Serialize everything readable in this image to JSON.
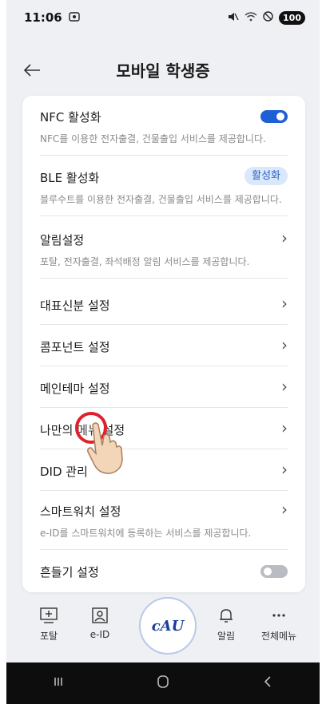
{
  "status_bar": {
    "time": "11:06",
    "battery": "100"
  },
  "header": {
    "title": "모바일 학생증"
  },
  "settings": {
    "nfc": {
      "label": "NFC 활성화",
      "desc": "NFC를 이용한 전자출결, 건물출입 서비스를 제공합니다.",
      "enabled": true
    },
    "ble": {
      "label": "BLE 활성화",
      "desc": "블루수트를 이용한 전자출결, 건물출입 서비스를 제공합니다.",
      "badge": "활성화"
    },
    "alarm": {
      "label": "알림설정",
      "desc": "포탈, 전자출결, 좌석배정 알림 서비스를 제공합니다."
    },
    "identity": {
      "label": "대표신분 설정"
    },
    "component": {
      "label": "콤포넌트 설정"
    },
    "theme": {
      "label": "메인테마 설정"
    },
    "mymenu": {
      "label": "나만의 메뉴 설정"
    },
    "did": {
      "label": "DID 관리"
    },
    "smartwatch": {
      "label": "스마트워치 설정",
      "desc": "e-ID를 스마트워치에 등록하는 서비스를 제공합니다."
    },
    "shake": {
      "label": "흔들기 설정",
      "enabled": false
    }
  },
  "bottom_nav": {
    "portal": "포탈",
    "eid": "e-ID",
    "center_logo": "cAU",
    "alarm": "알림",
    "all_menu": "전체메뉴"
  },
  "colors": {
    "accent": "#1f5fd6",
    "badge_bg": "#dbe8fb",
    "background": "#eef0f4",
    "tap_ring": "#e0202c"
  }
}
